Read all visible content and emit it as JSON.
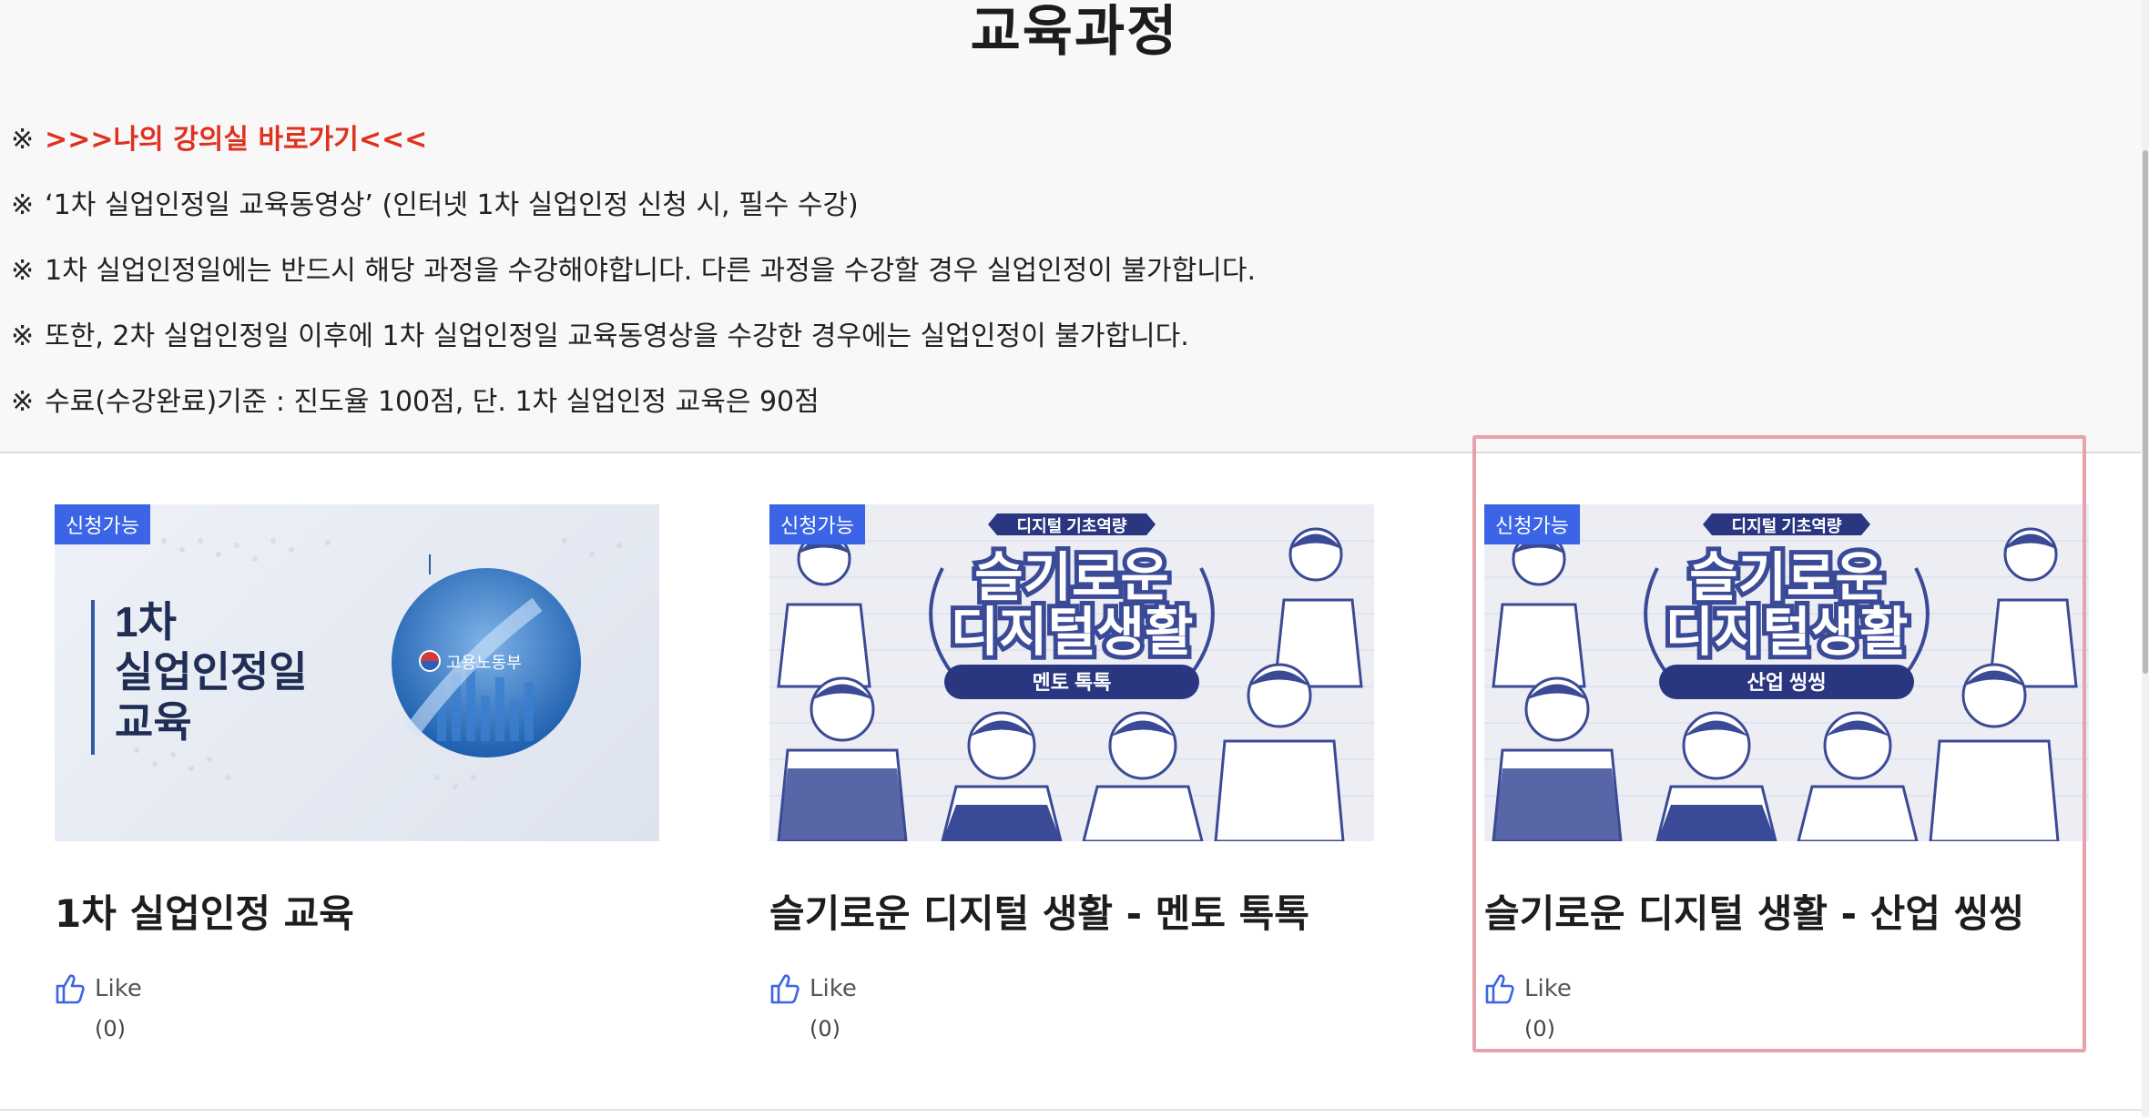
{
  "page": {
    "title": "교육과정"
  },
  "notices": [
    {
      "mark": "※",
      "text": ">>>나의 강의실 바로가기<<<",
      "is_link": true,
      "color": "#e0301e"
    },
    {
      "mark": "※",
      "text": "‘1차 실업인정일 교육동영상’ (인터넷 1차 실업인정 신청 시, 필수 수강)"
    },
    {
      "mark": "※",
      "text": "1차 실업인정일에는 반드시 해당 과정을 수강해야합니다. 다른 과정을 수강할 경우 실업인정이 불가합니다."
    },
    {
      "mark": "※",
      "text": "또한, 2차 실업인정일 이후에 1차 실업인정일 교육동영상을 수강한 경우에는 실업인정이 불가합니다."
    },
    {
      "mark": "※",
      "text": "수료(수강완료)기준 : 진도율 100점, 단. 1차 실업인정 교육은 90점"
    }
  ],
  "courses": [
    {
      "badge": "신청가능",
      "title": "1차 실업인정 교육",
      "thumb": {
        "heading_lines": [
          "1차",
          "실업인정일",
          "교육"
        ],
        "logo_text": "고용노동부"
      },
      "like_label": "Like",
      "like_count": "(0)"
    },
    {
      "badge": "신청가능",
      "title": "슬기로운 디지털 생활 - 멘토 톡톡",
      "thumb": {
        "ribbon": "디지털 기초역량",
        "line1": "슬기로운",
        "line2": "디지털생활",
        "sub": "멘토 톡톡"
      },
      "like_label": "Like",
      "like_count": "(0)"
    },
    {
      "badge": "신청가능",
      "title": "슬기로운 디지털 생활 - 산업 씽씽",
      "thumb": {
        "ribbon": "디지털 기초역량",
        "line1": "슬기로운",
        "line2": "디지털생활",
        "sub": "산업 씽씽"
      },
      "like_label": "Like",
      "like_count": "(0)"
    }
  ],
  "colors": {
    "accent": "#3b64e6",
    "link": "#e0301e",
    "poster_navy": "#3b4a96",
    "highlight": "#e8a2ac"
  },
  "icons": {
    "like": "thumbs-up-icon",
    "logo": "government-emblem-icon"
  }
}
